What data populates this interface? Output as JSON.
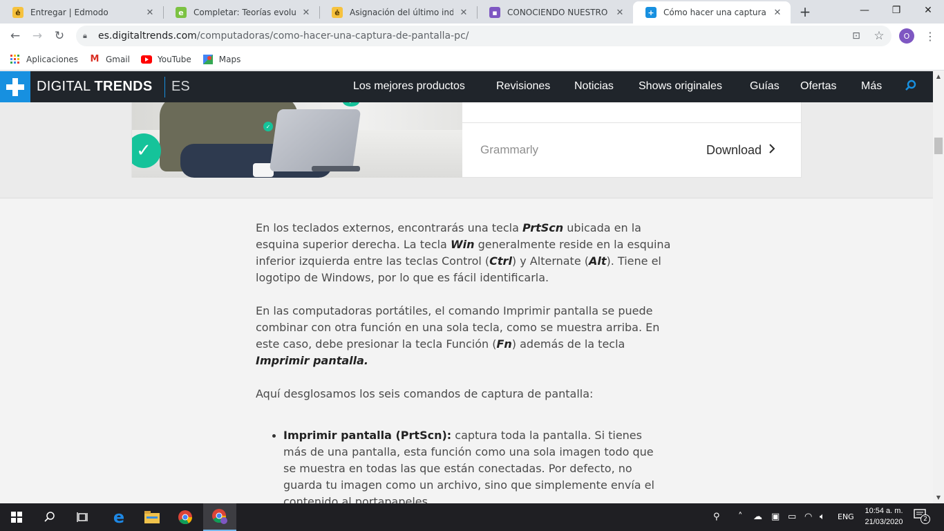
{
  "tabs": [
    {
      "title": "Entregar | Edmodo",
      "icon": "edmodo-icon",
      "color": "#f6c23e"
    },
    {
      "title": "Completar: Teorías evolutivas (",
      "icon": "edmodo-green-icon",
      "color": "#7cc242"
    },
    {
      "title": "Asignación del último indicado",
      "icon": "edmodo-icon",
      "color": "#f6c23e"
    },
    {
      "title": "CONOCIENDO NUESTRO LIBR",
      "icon": "classroom-icon",
      "color": "#7e57c2"
    },
    {
      "title": "Cómo hacer una captura de pa",
      "icon": "digitaltrends-icon",
      "color": "#1790e0",
      "active": true
    }
  ],
  "url": {
    "domain": "es.digitaltrends.com",
    "path": "/computadoras/como-hacer-una-captura-de-pantalla-pc/"
  },
  "profile_initial": "O",
  "bookmarks": [
    {
      "label": "Aplicaciones",
      "icon": "apps-grid-icon"
    },
    {
      "label": "Gmail",
      "icon": "gmail-icon"
    },
    {
      "label": "YouTube",
      "icon": "youtube-icon"
    },
    {
      "label": "Maps",
      "icon": "maps-icon"
    }
  ],
  "site": {
    "brand_a": "DIGITAL",
    "brand_b": "TRENDS",
    "edition": "ES",
    "nav": [
      "Los mejores productos",
      "Revisiones",
      "Noticias",
      "Shows originales",
      "Guías",
      "Ofertas",
      "Más"
    ],
    "accent": "#1790e0",
    "nav_bg": "#20252b"
  },
  "ad": {
    "brand": "Grammarly",
    "cta": "Download"
  },
  "article": {
    "p1": {
      "a": "En los teclados externos, encontrarás una tecla ",
      "b": "PrtScn",
      "c": " ubicada en la esquina superior derecha. La tecla ",
      "d": "Win",
      "e": " generalmente reside en la esquina inferior izquierda entre las teclas Control (",
      "f": "Ctrl",
      "g": ") y Alternate (",
      "h": "Alt",
      "i": "). Tiene el logotipo de Windows, por lo que es fácil identificarla."
    },
    "p2": {
      "a": "En las computadoras portátiles, el comando Imprimir pantalla se puede combinar con otra función en una sola tecla, como se muestra arriba. En este caso, debe presionar la tecla Función (",
      "b": "Fn",
      "c": ") además de la tecla ",
      "d": "Imprimir pantalla."
    },
    "p3": "Aquí desglosamos los seis comandos de captura de pantalla:",
    "li1_lead": "Imprimir pantalla (PrtScn):",
    "li1_text": " captura toda la pantalla. Si tienes más de una pantalla, esta función como una sola imagen todo que se muestra en todas las que están conectadas. Por defecto, no guarda tu imagen como un archivo, sino que simplemente envía el contenido al portapapeles."
  },
  "taskbar": {
    "apps": [
      "start-icon",
      "search-icon",
      "task-view-icon",
      "edge-icon",
      "file-explorer-icon",
      "chrome-icon",
      "chrome-profile-icon"
    ],
    "lang": "ENG",
    "time": "10:54 a. m.",
    "date": "21/03/2020",
    "notifications": "2"
  }
}
